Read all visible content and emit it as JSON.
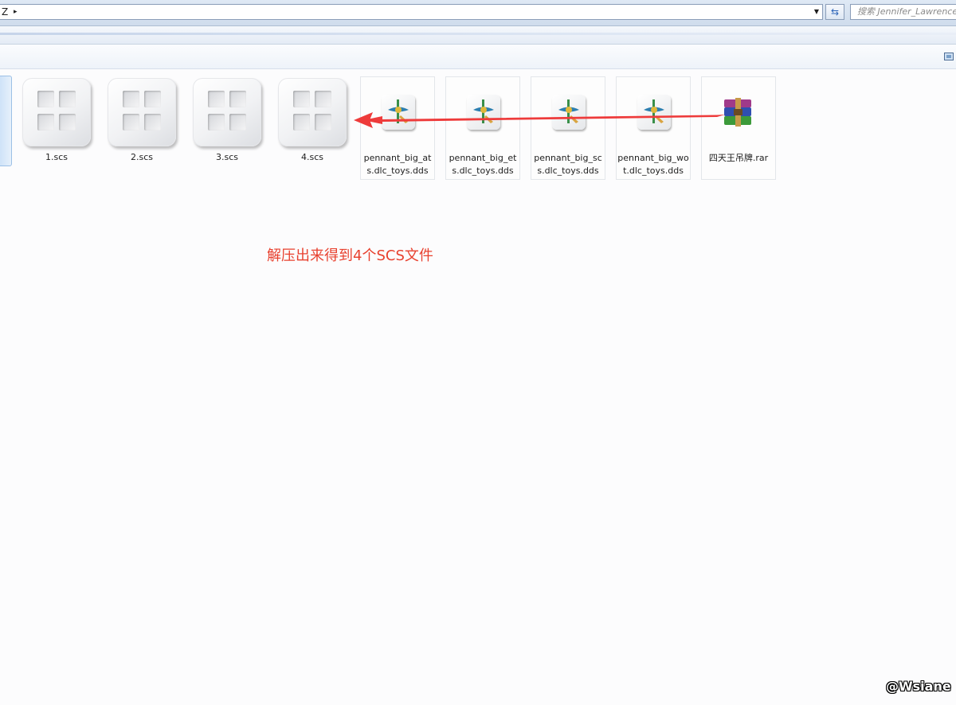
{
  "address_bar": {
    "path_text": "Z",
    "chevron": "▸",
    "dropdown_icon": "chevron-down-icon",
    "refresh_icon": "refresh-icon",
    "search_placeholder": "搜索 Jennifer_Lawrence"
  },
  "files": [
    {
      "name": "1.scs",
      "type": "scs"
    },
    {
      "name": "2.scs",
      "type": "scs"
    },
    {
      "name": "3.scs",
      "type": "scs"
    },
    {
      "name": "4.scs",
      "type": "scs"
    },
    {
      "name": "pennant_big_ats.dlc_toys.dds",
      "type": "dds"
    },
    {
      "name": "pennant_big_ets.dlc_toys.dds",
      "type": "dds"
    },
    {
      "name": "pennant_big_scs.dlc_toys.dds",
      "type": "dds"
    },
    {
      "name": "pennant_big_wot.dlc_toys.dds",
      "type": "dds"
    },
    {
      "name": "四天王吊牌.rar",
      "type": "rar"
    }
  ],
  "annotation": {
    "text": "解压出来得到4个SCS文件",
    "color": "#e8412f"
  },
  "watermark": "@Wsiane"
}
